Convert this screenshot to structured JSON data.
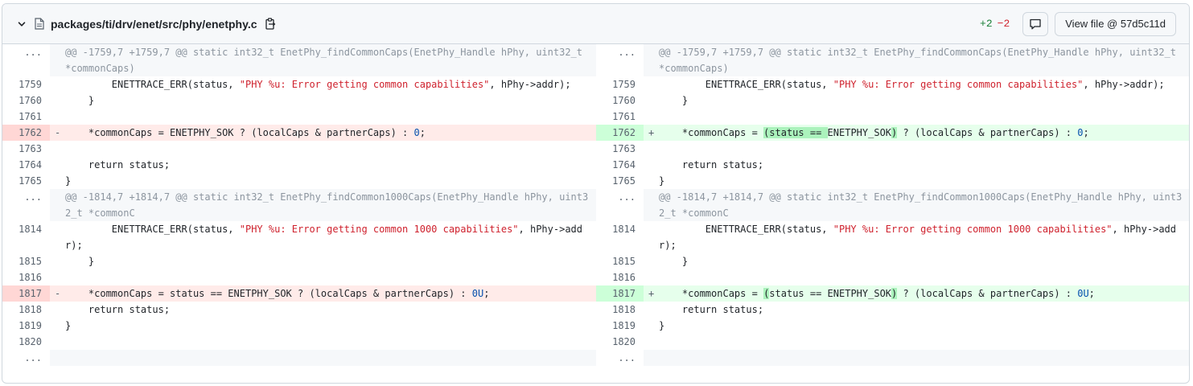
{
  "header": {
    "file_path": "packages/ti/drv/enet/src/phy/enetphy.c",
    "additions": "+2",
    "deletions": "−2",
    "view_file_label": "View file @ 57d5c11d"
  },
  "icons": {
    "collapse": "chevron-down-icon",
    "file": "file-icon",
    "copy": "copy-icon",
    "comment": "comment-icon"
  },
  "colors": {
    "addition": "#1a7f37",
    "deletion": "#d1242f",
    "added_bg": "#e6ffec",
    "removed_bg": "#ffebe9"
  },
  "left": {
    "rows": [
      {
        "n": "...",
        "m": "",
        "t": "hunk",
        "segs": [
          {
            "c": "@@ -1759,7 +1759,7 @@ static int32_t EnetPhy_findCommonCaps(EnetPhy_Handle hPhy, uint32_t *commonCaps)"
          }
        ]
      },
      {
        "n": "1759",
        "m": "",
        "t": "ctx",
        "segs": [
          {
            "c": "        ENETTRACE_ERR(status, "
          },
          {
            "c": "\"PHY %u: Error getting common capabilities\"",
            "k": "str"
          },
          {
            "c": ", hPhy->addr);"
          }
        ]
      },
      {
        "n": "1760",
        "m": "",
        "t": "ctx",
        "segs": [
          {
            "c": "    }"
          }
        ]
      },
      {
        "n": "1761",
        "m": "",
        "t": "ctx",
        "segs": [
          {
            "c": ""
          }
        ]
      },
      {
        "n": "1762",
        "m": "-",
        "t": "del",
        "segs": [
          {
            "c": "    *commonCaps = ENETPHY_SOK ? (localCaps & partnerCaps) : "
          },
          {
            "c": "0",
            "k": "num"
          },
          {
            "c": ";"
          }
        ]
      },
      {
        "n": "1763",
        "m": "",
        "t": "ctx",
        "segs": [
          {
            "c": ""
          }
        ]
      },
      {
        "n": "1764",
        "m": "",
        "t": "ctx",
        "segs": [
          {
            "c": "    return status;"
          }
        ]
      },
      {
        "n": "1765",
        "m": "",
        "t": "ctx",
        "segs": [
          {
            "c": "}"
          }
        ]
      },
      {
        "n": "...",
        "m": "",
        "t": "hunk",
        "segs": [
          {
            "c": "@@ -1814,7 +1814,7 @@ static int32_t EnetPhy_findCommon1000Caps(EnetPhy_Handle hPhy, uint32_t *commonC"
          }
        ]
      },
      {
        "n": "1814",
        "m": "",
        "t": "ctx",
        "segs": [
          {
            "c": "        ENETTRACE_ERR(status, "
          },
          {
            "c": "\"PHY %u: Error getting common 1000 capabilities\"",
            "k": "str"
          },
          {
            "c": ", hPhy->addr);"
          }
        ]
      },
      {
        "n": "1815",
        "m": "",
        "t": "ctx",
        "segs": [
          {
            "c": "    }"
          }
        ]
      },
      {
        "n": "1816",
        "m": "",
        "t": "ctx",
        "segs": [
          {
            "c": ""
          }
        ]
      },
      {
        "n": "1817",
        "m": "-",
        "t": "del",
        "segs": [
          {
            "c": "    *commonCaps = status == ENETPHY_SOK ? (localCaps & partnerCaps) : "
          },
          {
            "c": "0U",
            "k": "num"
          },
          {
            "c": ";"
          }
        ]
      },
      {
        "n": "1818",
        "m": "",
        "t": "ctx",
        "segs": [
          {
            "c": "    return status;"
          }
        ]
      },
      {
        "n": "1819",
        "m": "",
        "t": "ctx",
        "segs": [
          {
            "c": "}"
          }
        ]
      },
      {
        "n": "1820",
        "m": "",
        "t": "ctx",
        "segs": [
          {
            "c": ""
          }
        ]
      },
      {
        "n": "...",
        "m": "",
        "t": "tail",
        "segs": [
          {
            "c": ""
          }
        ]
      }
    ]
  },
  "right": {
    "rows": [
      {
        "n": "...",
        "m": "",
        "t": "hunk",
        "segs": [
          {
            "c": "@@ -1759,7 +1759,7 @@ static int32_t EnetPhy_findCommonCaps(EnetPhy_Handle hPhy, uint32_t *commonCaps)"
          }
        ]
      },
      {
        "n": "1759",
        "m": "",
        "t": "ctx",
        "segs": [
          {
            "c": "        ENETTRACE_ERR(status, "
          },
          {
            "c": "\"PHY %u: Error getting common capabilities\"",
            "k": "str"
          },
          {
            "c": ", hPhy->addr);"
          }
        ]
      },
      {
        "n": "1760",
        "m": "",
        "t": "ctx",
        "segs": [
          {
            "c": "    }"
          }
        ]
      },
      {
        "n": "1761",
        "m": "",
        "t": "ctx",
        "segs": [
          {
            "c": ""
          }
        ]
      },
      {
        "n": "1762",
        "m": "+",
        "t": "add",
        "segs": [
          {
            "c": "    *commonCaps = "
          },
          {
            "c": "(status == ",
            "k": "hl"
          },
          {
            "c": "ENETPHY_SOK"
          },
          {
            "c": ")",
            "k": "hl"
          },
          {
            "c": " ? (localCaps & partnerCaps) : "
          },
          {
            "c": "0",
            "k": "num"
          },
          {
            "c": ";"
          }
        ]
      },
      {
        "n": "1763",
        "m": "",
        "t": "ctx",
        "segs": [
          {
            "c": ""
          }
        ]
      },
      {
        "n": "1764",
        "m": "",
        "t": "ctx",
        "segs": [
          {
            "c": "    return status;"
          }
        ]
      },
      {
        "n": "1765",
        "m": "",
        "t": "ctx",
        "segs": [
          {
            "c": "}"
          }
        ]
      },
      {
        "n": "...",
        "m": "",
        "t": "hunk",
        "segs": [
          {
            "c": "@@ -1814,7 +1814,7 @@ static int32_t EnetPhy_findCommon1000Caps(EnetPhy_Handle hPhy, uint32_t *commonC"
          }
        ]
      },
      {
        "n": "1814",
        "m": "",
        "t": "ctx",
        "segs": [
          {
            "c": "        ENETTRACE_ERR(status, "
          },
          {
            "c": "\"PHY %u: Error getting common 1000 capabilities\"",
            "k": "str"
          },
          {
            "c": ", hPhy->addr);"
          }
        ]
      },
      {
        "n": "1815",
        "m": "",
        "t": "ctx",
        "segs": [
          {
            "c": "    }"
          }
        ]
      },
      {
        "n": "1816",
        "m": "",
        "t": "ctx",
        "segs": [
          {
            "c": ""
          }
        ]
      },
      {
        "n": "1817",
        "m": "+",
        "t": "add",
        "segs": [
          {
            "c": "    *commonCaps = "
          },
          {
            "c": "(",
            "k": "hl"
          },
          {
            "c": "status == ENETPHY_SOK"
          },
          {
            "c": ")",
            "k": "hl"
          },
          {
            "c": " ? (localCaps & partnerCaps) : "
          },
          {
            "c": "0U",
            "k": "num"
          },
          {
            "c": ";"
          }
        ]
      },
      {
        "n": "1818",
        "m": "",
        "t": "ctx",
        "segs": [
          {
            "c": "    return status;"
          }
        ]
      },
      {
        "n": "1819",
        "m": "",
        "t": "ctx",
        "segs": [
          {
            "c": "}"
          }
        ]
      },
      {
        "n": "1820",
        "m": "",
        "t": "ctx",
        "segs": [
          {
            "c": ""
          }
        ]
      },
      {
        "n": "...",
        "m": "",
        "t": "tail",
        "segs": [
          {
            "c": ""
          }
        ]
      }
    ]
  }
}
